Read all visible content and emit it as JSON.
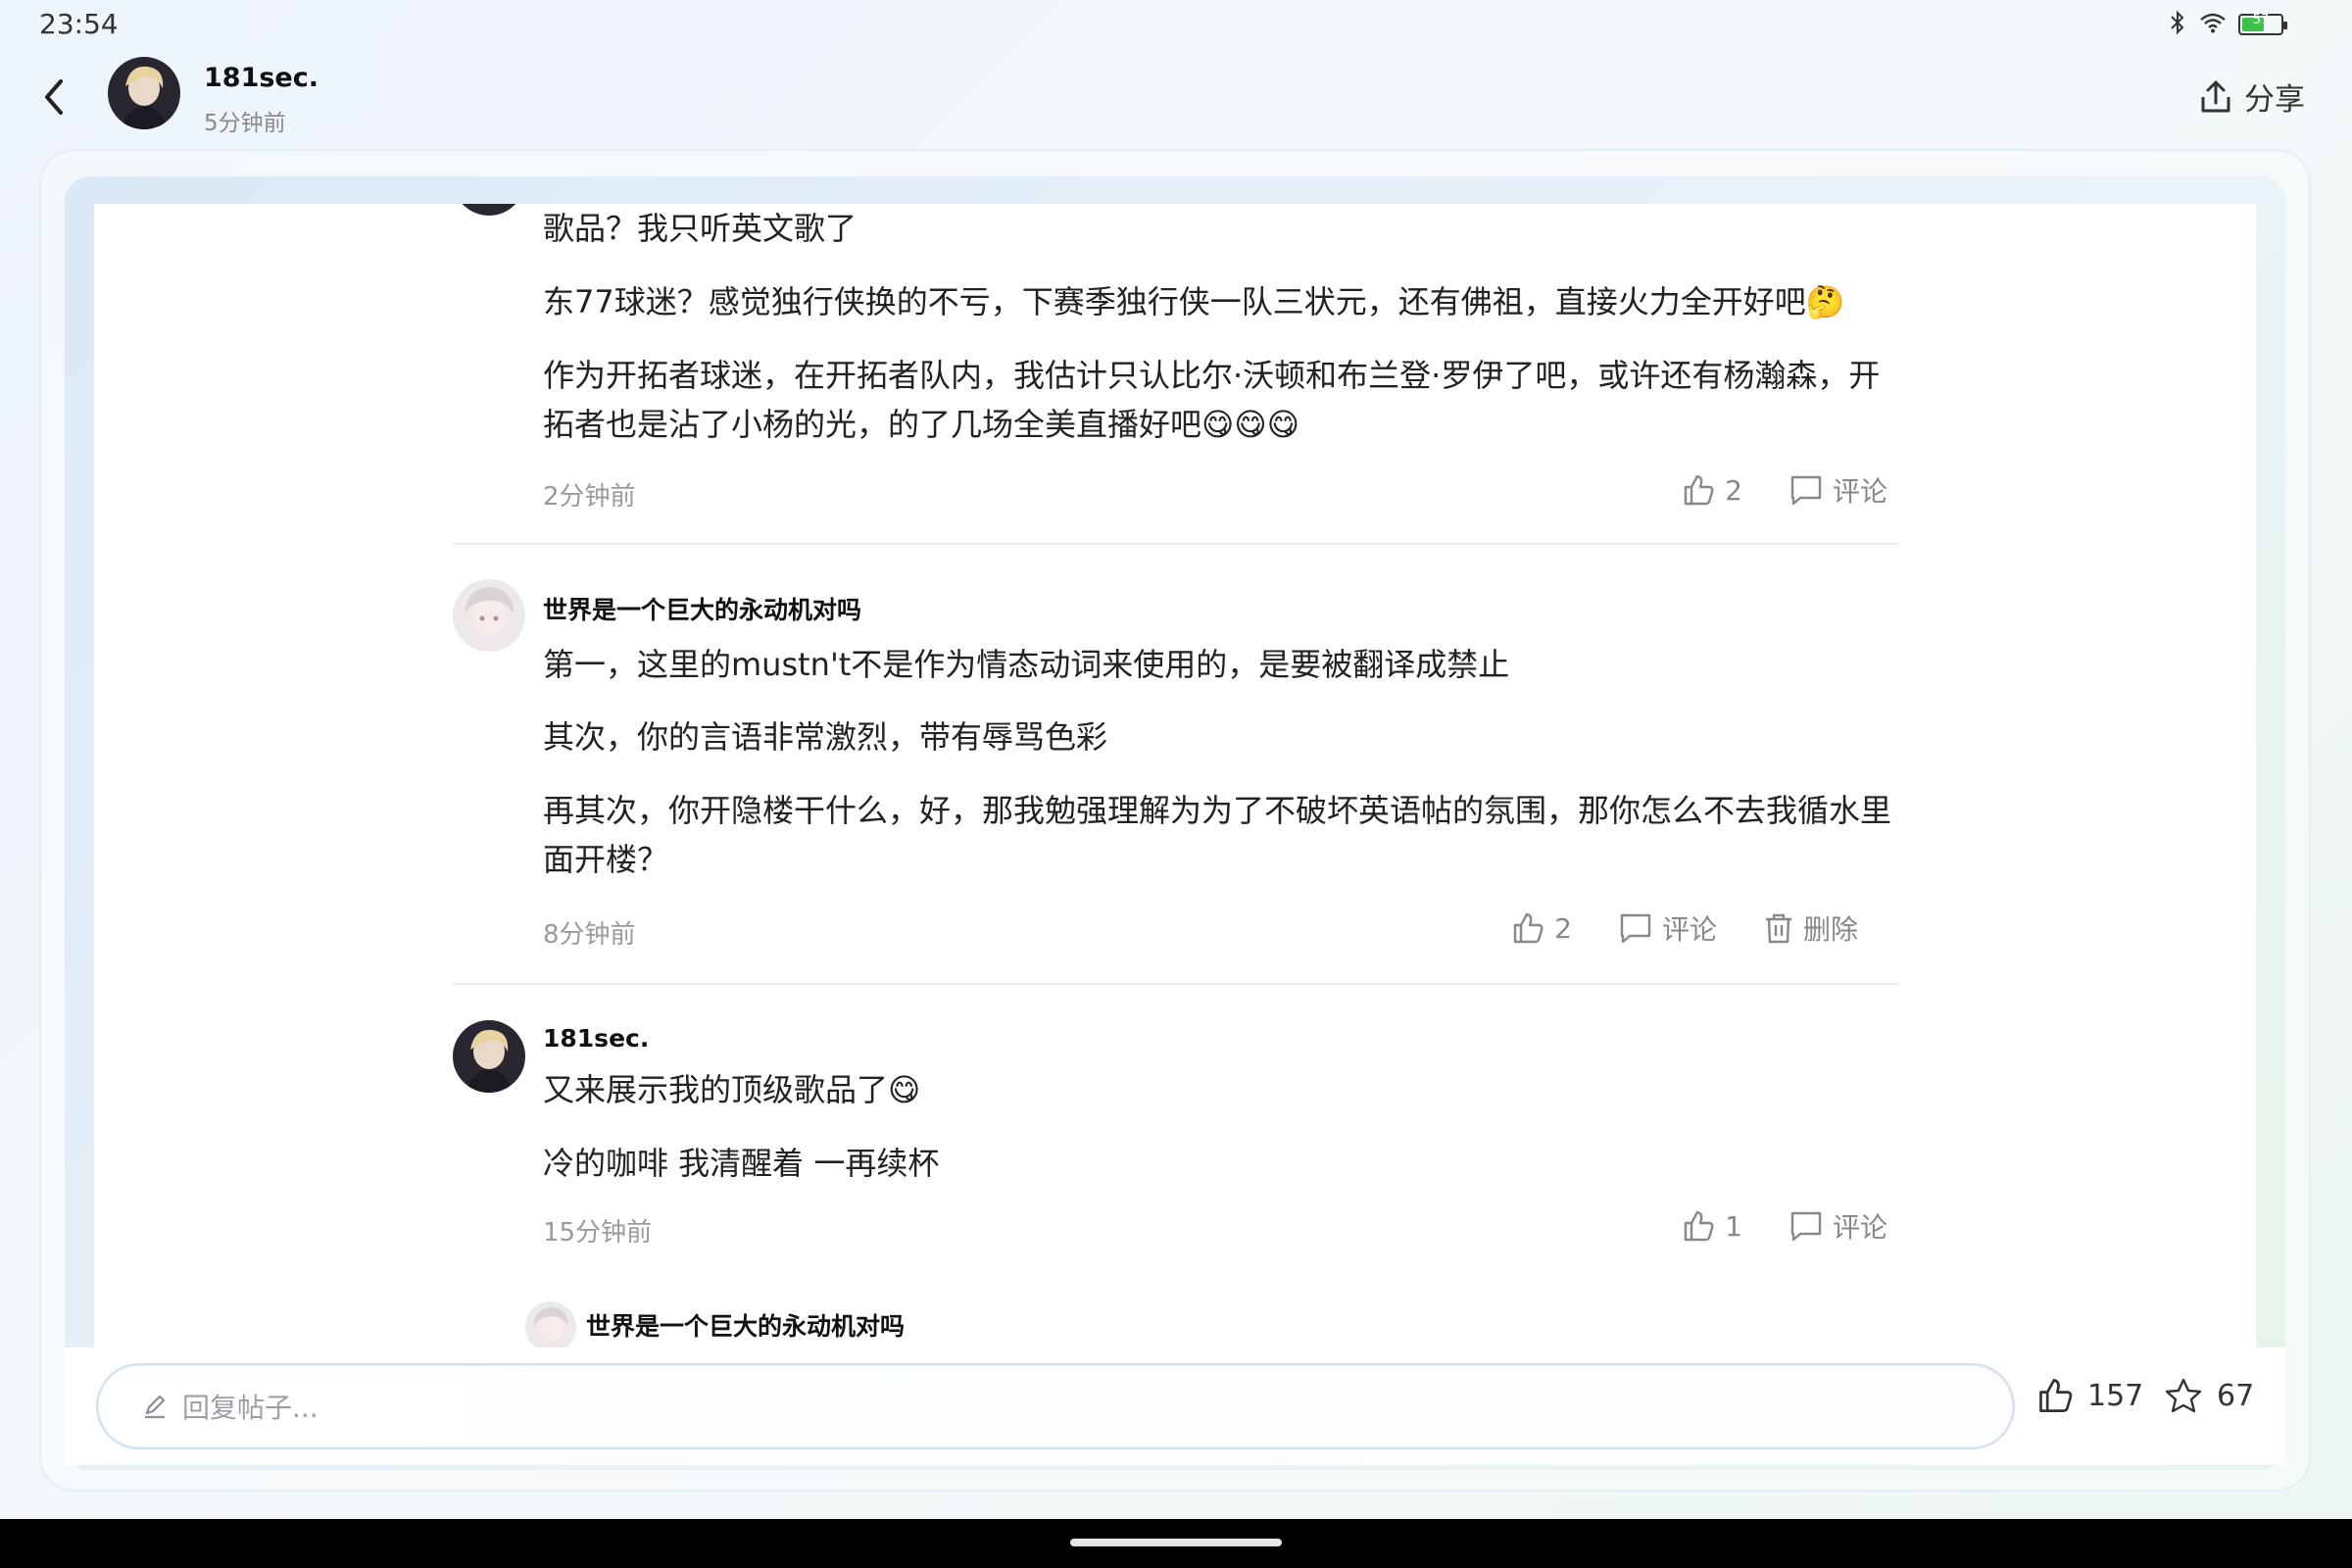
{
  "status_bar": {
    "time": "23:54",
    "battery_level": "57"
  },
  "header": {
    "username": "181sec.",
    "time": "5分钟前",
    "share_label": "分享"
  },
  "comments": [
    {
      "lines": [
        "歌品？我只听英文歌了",
        "东77球迷？感觉独行侠换的不亏，下赛季独行侠一队三状元，还有佛祖，直接火力全开好吧🤔",
        "作为开拓者球迷，在开拓者队内，我估计只认比尔·沃顿和布兰登·罗伊了吧，或许还有杨瀚森，开",
        "拓者也是沾了小杨的光，的了几场全美直播好吧😋😋😋"
      ],
      "time": "2分钟前",
      "likes": "2",
      "comment_label": "评论"
    },
    {
      "author": "世界是一个巨大的永动机对吗",
      "lines": [
        "第一，这里的mustn't不是作为情态动词来使用的，是要被翻译成禁止",
        "其次，你的言语非常激烈，带有辱骂色彩",
        "再其次，你开隐楼干什么，好，那我勉强理解为为了不破坏英语帖的氛围，那你怎么不去我循水里",
        "面开楼？"
      ],
      "time": "8分钟前",
      "likes": "2",
      "comment_label": "评论",
      "delete_label": "删除"
    },
    {
      "author": "181sec.",
      "lines": [
        "又来展示我的顶级歌品了😋",
        "冷的咖啡 我清醒着 一再续杯"
      ],
      "time": "15分钟前",
      "likes": "1",
      "comment_label": "评论"
    }
  ],
  "reply_preview": {
    "author": "世界是一个巨大的永动机对吗"
  },
  "bottom_bar": {
    "placeholder": "回复帖子...",
    "like_count": "157",
    "favorite_count": "67"
  }
}
